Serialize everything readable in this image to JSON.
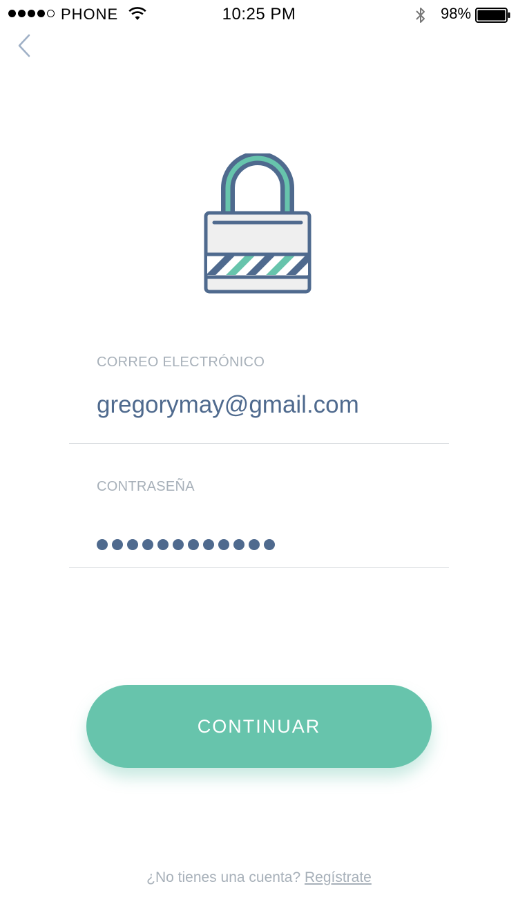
{
  "status_bar": {
    "carrier": "PHONE",
    "time": "10:25 PM",
    "battery_percent": "98%",
    "signal_bars_filled": 4,
    "signal_bars_total": 5,
    "battery_level": 0.98
  },
  "nav": {
    "back_icon": "chevron-left-icon"
  },
  "illustration": {
    "icon": "padlock-icon",
    "colors": {
      "outline": "#4f6a8e",
      "accent": "#67c4ac",
      "fill": "#efefef"
    }
  },
  "form": {
    "email": {
      "label": "CORREO ELECTRÓNICO",
      "value": "gregorymay@gmail.com"
    },
    "password": {
      "label": "CONTRASEÑA",
      "masked_length": 12
    }
  },
  "actions": {
    "continue_label": "CONTINUAR"
  },
  "footer": {
    "prompt": "¿No tienes una cuenta?",
    "link": "Regístrate"
  },
  "colors": {
    "primary": "#67c4ac",
    "text_value": "#4f6a8e",
    "text_muted": "#a7b0b9",
    "divider": "#d6d9dd"
  }
}
